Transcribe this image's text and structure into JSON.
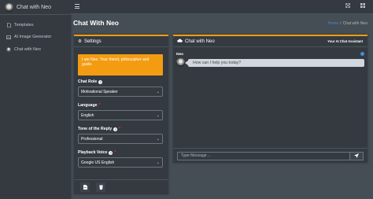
{
  "app": {
    "brand": "Chat with Neo"
  },
  "sidebar": {
    "items": [
      {
        "label": "Templates",
        "icon": "file-icon"
      },
      {
        "label": "AI Image Generator",
        "icon": "image-icon"
      },
      {
        "label": "Chat with Neo",
        "icon": "neo-avatar-icon"
      }
    ]
  },
  "topbar": {
    "menu_icon": "hamburger-icon",
    "right_icons": [
      "expand-icon",
      "grid-icon"
    ]
  },
  "header": {
    "title": "Chat With Neo",
    "breadcrumb_home": "Home",
    "breadcrumb_sep": "/",
    "breadcrumb_current": "Chat with Neo"
  },
  "settings": {
    "title": "Settings",
    "callout": "I am Neo. Your friend, philosopher and guide.",
    "chat_role": {
      "label": "Chat Role",
      "value": "Motivational Speaker"
    },
    "language": {
      "label": "Language",
      "value": "English"
    },
    "tone": {
      "label": "Tone of the Reply",
      "value": "Professional"
    },
    "voice": {
      "label": "Playback Voice",
      "value": "Google US English"
    },
    "accent": "#f39c12"
  },
  "chat": {
    "title": "Chat with Neo",
    "tools_label": "Your AI Chat Assistant",
    "sender": "Neo",
    "message": "How can I help you today?",
    "input_placeholder": "Type Message ..."
  }
}
